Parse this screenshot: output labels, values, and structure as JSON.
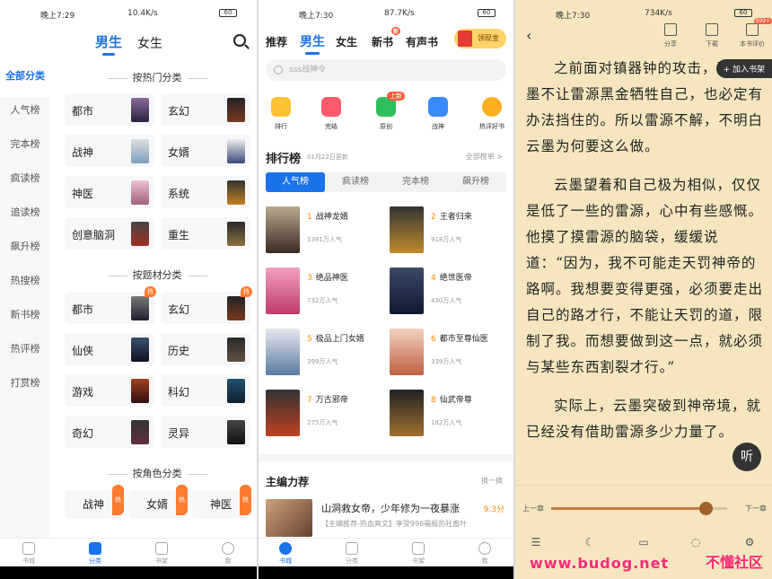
{
  "panel1": {
    "status": {
      "time": "晚上7:29",
      "speed": "10.4K/s",
      "battery": "60"
    },
    "tabs": [
      "男生",
      "女生"
    ],
    "leftnav": [
      "全部分类",
      "人气榜",
      "完本榜",
      "疯读榜",
      "追读榜",
      "飙升榜",
      "热搜榜",
      "新书榜",
      "热评榜",
      "打赏榜"
    ],
    "sections": [
      "按热门分类",
      "按题材分类",
      "按角色分类"
    ],
    "hot_categories": [
      "都市",
      "玄幻",
      "战神",
      "女婿",
      "神医",
      "系统",
      "创意脑洞",
      "重生"
    ],
    "theme_categories": [
      "都市",
      "玄幻",
      "仙侠",
      "历史",
      "游戏",
      "科幻",
      "奇幻",
      "灵异"
    ],
    "role_categories": [
      "战神",
      "女婿",
      "神医"
    ],
    "hot_badge": "热",
    "bottom_nav": [
      "书城",
      "分类",
      "书架",
      "我"
    ]
  },
  "panel2": {
    "status": {
      "time": "晚上7:30",
      "speed": "87.7K/s",
      "battery": "60"
    },
    "tabs": [
      "推荐",
      "男生",
      "女生",
      "新书",
      "有声书"
    ],
    "new_badge": "新",
    "redpack": "领现金",
    "search_placeholder": "sss战神令",
    "quick_icons": [
      "排行",
      "完结",
      "原创",
      "战神",
      "热评好书"
    ],
    "quick_icon_badge": "上新",
    "rank_title": "排行榜",
    "rank_date": "01月22日更新",
    "rank_all": "全部榜单 >",
    "rank_tabs": [
      "人气榜",
      "疯读榜",
      "完本榜",
      "飙升榜"
    ],
    "rank_items": [
      {
        "no": "1",
        "name": "战神龙婿",
        "pop": "1381万人气"
      },
      {
        "no": "2",
        "name": "王者归来",
        "pop": "918万人气"
      },
      {
        "no": "3",
        "name": "绝品神医",
        "pop": "732万人气"
      },
      {
        "no": "4",
        "name": "绝世医帝",
        "pop": "430万人气"
      },
      {
        "no": "5",
        "name": "极品上门女婿",
        "pop": "399万人气"
      },
      {
        "no": "6",
        "name": "都市至尊仙医",
        "pop": "339万人气"
      },
      {
        "no": "7",
        "name": "万古邪帝",
        "pop": "275万人气"
      },
      {
        "no": "8",
        "name": "仙武帝尊",
        "pop": "182万人气"
      }
    ],
    "editor_title": "主编力荐",
    "editor_more": "换一换",
    "editor_book": {
      "name": "山洞救女帝，少年修为一夜暴涨",
      "score": "9.3分",
      "desc": "【主编推荐-热血爽文】享受996福报的社畜叶"
    },
    "bottom_nav": [
      "书城",
      "分类",
      "书架",
      "我"
    ]
  },
  "panel3": {
    "status": {
      "time": "晚上7:30",
      "speed": "734K/s",
      "battery": "60"
    },
    "tools": [
      "分享",
      "下载",
      "本书评价"
    ],
    "tool_badge": "999+",
    "add_shelf": "+ 加入书架",
    "paragraphs": [
      "之前面对镇器钟的攻击，恐怕云墨不让雷源黑金牺牲自己，也必定有办法挡住的。所以雷源不解，不明白云墨为何要这么做。",
      "云墨望着和自己极为相似，仅仅是低了一些的雷源，心中有些感慨。他摸了摸雷源的脑袋，缓缓说道：“因为，我不可能走天罚神帝的路啊。我想要变得更强，必须要走出自己的路才行，不能让天罚的道，限制了我。而想要做到这一点，就必须与某些东西割裂才行。”",
      "实际上，云墨突破到神帝境，就已经没有借助雷源多少力量了。"
    ],
    "listen": "听",
    "prev_chapter": "上一章",
    "next_chapter": "下一章",
    "progress": 0.88,
    "watermark": "www.budog.net",
    "watermark2": "不懂社区"
  }
}
